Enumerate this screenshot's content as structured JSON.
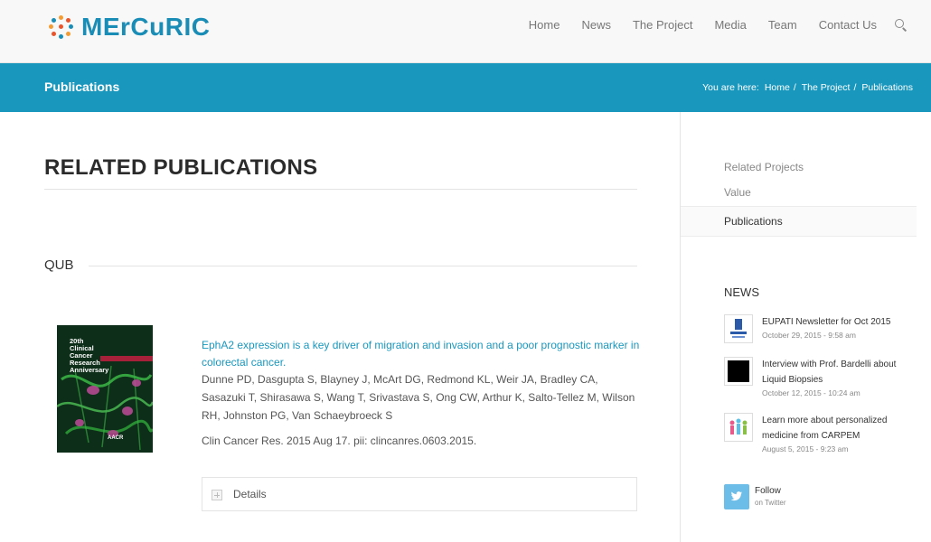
{
  "header": {
    "logo_text": "MErCuRIC",
    "nav": [
      "Home",
      "News",
      "The Project",
      "Media",
      "Team",
      "Contact Us"
    ]
  },
  "titleband": {
    "title": "Publications",
    "breadcrumb_prefix": "You are here:",
    "breadcrumb": [
      "Home",
      "The Project",
      "Publications"
    ]
  },
  "main": {
    "heading": "RELATED PUBLICATIONS",
    "section": "QUB",
    "publication": {
      "title": "EphA2 expression is a key driver of migration and invasion and a poor prognostic marker in colorectal cancer.",
      "authors": "Dunne PD, Dasgupta S, Blayney J, McArt DG, Redmond KL, Weir JA, Bradley CA, Sasazuki T, Shirasawa S, Wang T, Srivastava S, Ong CW, Arthur K, Salto-Tellez M, Wilson RH, Johnston PG, Van Schaeybroeck S",
      "citation": "Clin Cancer Res. 2015 Aug 17. pii: clincanres.0603.2015.",
      "cover_text": "20th Clinical Cancer Research Anniversary",
      "cover_brand": "AACR",
      "details_label": "Details"
    }
  },
  "sidebar": {
    "items": [
      "Related Projects",
      "Value",
      "Publications"
    ],
    "news_heading": "NEWS",
    "news": [
      {
        "title": "EUPATI Newsletter for Oct 2015",
        "date": "October 29, 2015 - 9:58 am",
        "thumb": "eupati-logo"
      },
      {
        "title": "Interview with Prof. Bardelli about Liquid Biopsies",
        "date": "October 12, 2015 - 10:24 am",
        "thumb": "black-video-thumb"
      },
      {
        "title": "Learn more about personalized medicine from CARPEM",
        "date": "August 5, 2015 - 9:23 am",
        "thumb": "people-figures"
      }
    ],
    "follow_label": "Follow",
    "follow_sub": "on Twitter"
  },
  "colors": {
    "brand": "#1a97bd",
    "link": "#1a97bd",
    "twitter": "#6cbde8"
  }
}
